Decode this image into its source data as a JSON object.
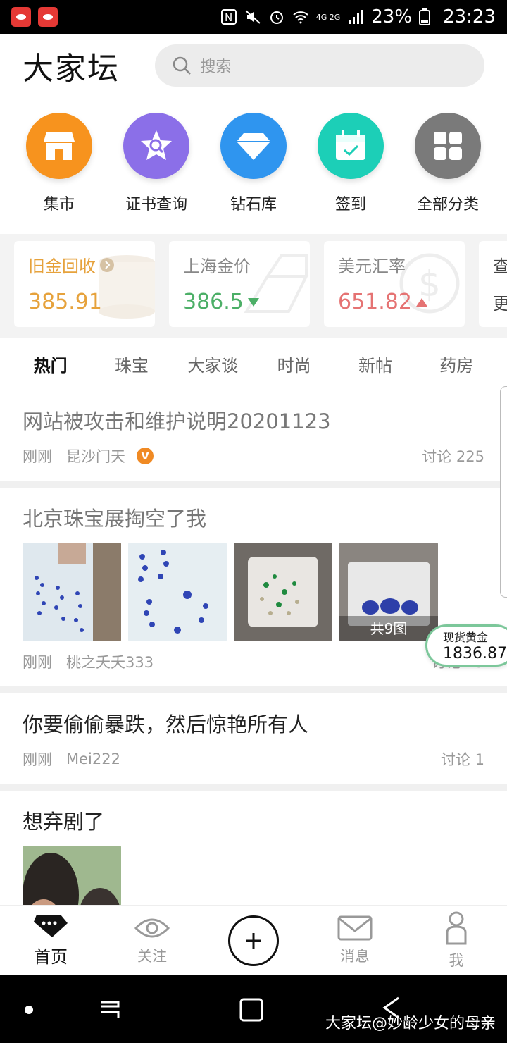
{
  "status_bar": {
    "battery": "23%",
    "time": "23:23",
    "network": "4G 2G"
  },
  "header": {
    "logo": "大家坛",
    "search_placeholder": "搜索"
  },
  "categories": [
    {
      "label": "集市",
      "icon": "store-icon",
      "color": "#f7931e"
    },
    {
      "label": "证书查询",
      "icon": "certificate-search-icon",
      "color": "#8b6fe8"
    },
    {
      "label": "钻石库",
      "icon": "diamond-icon",
      "color": "#2f95ef"
    },
    {
      "label": "签到",
      "icon": "calendar-check-icon",
      "color": "#1ccfb7"
    },
    {
      "label": "全部分类",
      "icon": "grid-icon",
      "color": "#7a7a7a"
    }
  ],
  "prices": [
    {
      "title": "旧金回收",
      "value": "385.91",
      "color": "#e6a23c",
      "trend": ""
    },
    {
      "title": "上海金价",
      "value": "386.5",
      "color": "#4caf67",
      "trend": "down"
    },
    {
      "title": "美元汇率",
      "value": "651.82",
      "color": "#e57373",
      "trend": "up"
    },
    {
      "title": "查",
      "value": "更",
      "color": "#444",
      "trend": ""
    }
  ],
  "tabs": [
    "热门",
    "珠宝",
    "大家谈",
    "时尚",
    "新帖",
    "药房"
  ],
  "active_tab": "热门",
  "posts": [
    {
      "title": "网站被攻击和维护说明20201123",
      "time": "刚刚",
      "author": "昆沙门天",
      "verified": true,
      "discuss": "讨论  225"
    },
    {
      "title": "北京珠宝展掏空了我",
      "time": "刚刚",
      "author": "桃之夭夭333",
      "image_count": "共9图",
      "discuss": "讨论 15"
    },
    {
      "title": "你要偷偷暴跌，然后惊艳所有人",
      "time": "刚刚",
      "author": "Mei222",
      "discuss": "讨论  1"
    },
    {
      "title": "想弃剧了"
    }
  ],
  "floating_gold": {
    "label": "现货黄金",
    "value": "1836.87"
  },
  "bottom_nav": {
    "home": "首页",
    "follow": "关注",
    "messages": "消息",
    "me": "我"
  },
  "watermark": "大家坛@妙龄少女的母亲"
}
